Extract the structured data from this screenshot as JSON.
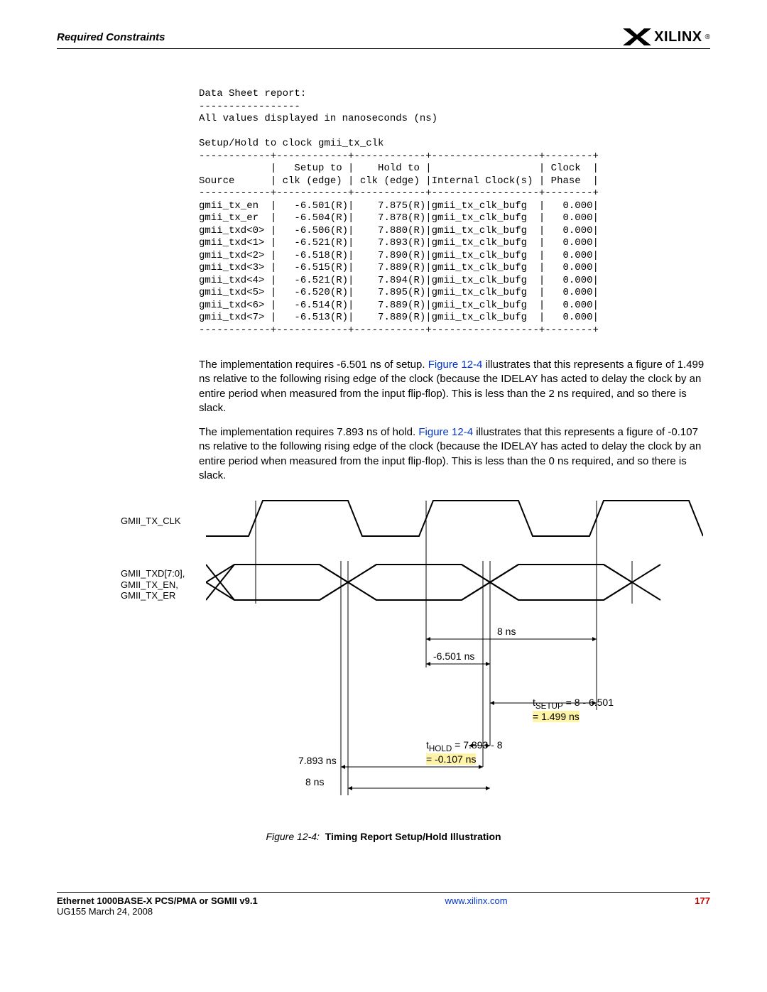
{
  "header": {
    "section_title": "Required Constraints",
    "logo_text": "XILINX",
    "logo_r": "®"
  },
  "report": {
    "title": "Data Sheet report:",
    "rule1": "-----------------",
    "subtitle": "All values displayed in nanoseconds (ns)",
    "tablehead": "Setup/Hold to clock gmii_tx_clk",
    "divider_top": "------------+------------+------------+------------------+--------+",
    "colhead1": "            |   Setup to |    Hold to |                  | Clock  |",
    "colhead2": "Source      | clk (edge) | clk (edge) |Internal Clock(s) | Phase  |",
    "divider_mid": "------------+------------+------------+------------------+--------+",
    "rows": [
      "gmii_tx_en  |   -6.501(R)|    7.875(R)|gmii_tx_clk_bufg  |   0.000|",
      "gmii_tx_er  |   -6.504(R)|    7.878(R)|gmii_tx_clk_bufg  |   0.000|",
      "gmii_txd<0> |   -6.506(R)|    7.880(R)|gmii_tx_clk_bufg  |   0.000|",
      "gmii_txd<1> |   -6.521(R)|    7.893(R)|gmii_tx_clk_bufg  |   0.000|",
      "gmii_txd<2> |   -6.518(R)|    7.890(R)|gmii_tx_clk_bufg  |   0.000|",
      "gmii_txd<3> |   -6.515(R)|    7.889(R)|gmii_tx_clk_bufg  |   0.000|",
      "gmii_txd<4> |   -6.521(R)|    7.894(R)|gmii_tx_clk_bufg  |   0.000|",
      "gmii_txd<5> |   -6.520(R)|    7.895(R)|gmii_tx_clk_bufg  |   0.000|",
      "gmii_txd<6> |   -6.514(R)|    7.889(R)|gmii_tx_clk_bufg  |   0.000|",
      "gmii_txd<7> |   -6.513(R)|    7.889(R)|gmii_tx_clk_bufg  |   0.000|"
    ],
    "divider_bot": "------------+------------+------------+------------------+--------+"
  },
  "para1_a": "The implementation requires -6.501 ns of setup. ",
  "para1_link": "Figure 12-4",
  "para1_b": " illustrates that this represents a figure of 1.499 ns relative to the following rising edge of the clock (because the IDELAY has acted to delay the clock by an entire period when measured from the input flip-flop). This is less than the 2 ns required, and so there is slack.",
  "para2_a": "The implementation requires 7.893 ns of hold. ",
  "para2_link": "Figure 12-4",
  "para2_b": " illustrates that this represents a figure of -0.107 ns relative to the following rising edge of the clock (because the IDELAY has acted to delay the clock by an entire period when measured from the input flip-flop). This is less than the 0 ns required, and so there is slack.",
  "fig": {
    "clk_label": "GMII_TX_CLK",
    "data_label": "GMII_TXD[7:0],\nGMII_TX_EN,\nGMII_TX_ER",
    "lbl_8ns_top": "8 ns",
    "lbl_minus6501": "-6.501 ns",
    "lbl_tsetup_a": "t",
    "lbl_tsetup_sub": "SETUP",
    "lbl_tsetup_b": "  = 8 - 6.501",
    "lbl_tsetup_res": "= 1.499 ns",
    "lbl_thold_a": "t",
    "lbl_thold_sub": "HOLD",
    "lbl_thold_b": "  = 7.893 - 8",
    "lbl_thold_res": "= -0.107 ns",
    "lbl_7893": "7.893 ns",
    "lbl_8ns_bot": "8 ns",
    "caption_prefix": "Figure 12-4:",
    "caption_title": "Timing Report Setup/Hold Illustration"
  },
  "footer": {
    "left_main": "Ethernet 1000BASE-X PCS/PMA or SGMII v9.1",
    "left_sub": "UG155 March 24, 2008",
    "mid": "www.xilinx.com",
    "right": "177"
  }
}
